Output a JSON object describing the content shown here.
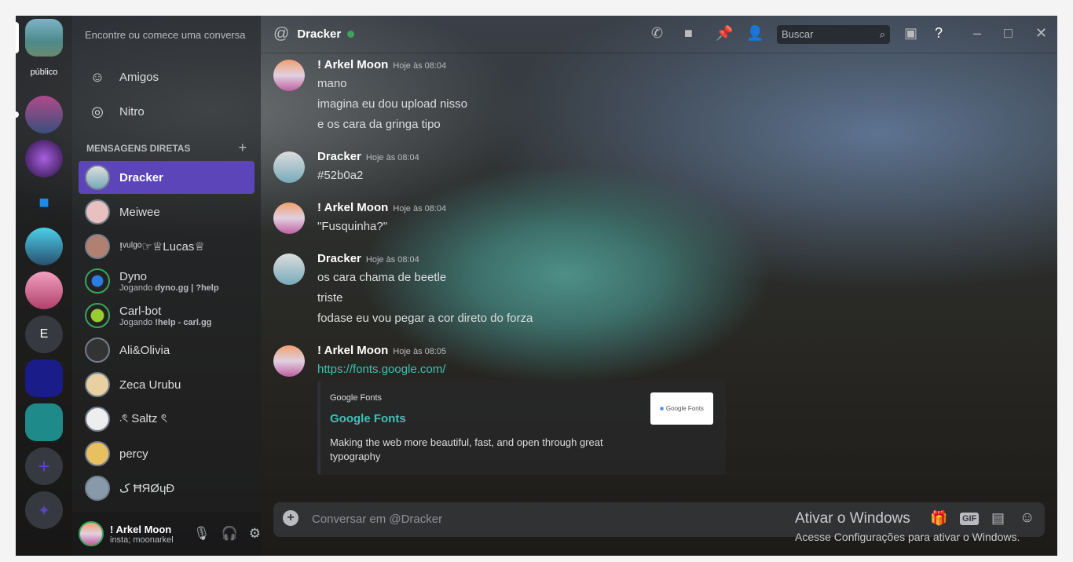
{
  "servers": {
    "public_label": "público",
    "letter_server": "E"
  },
  "sidebar": {
    "search_placeholder": "Encontre ou comece uma conversa",
    "friends": "Amigos",
    "nitro": "Nitro",
    "dm_header": "MENSAGENS DIRETAS",
    "dms": [
      {
        "name": "Dracker"
      },
      {
        "name": "Meiwee"
      },
      {
        "name": "!ᵛᵘˡᵍᵒ☞♕Lucas♕"
      },
      {
        "name": "Dyno",
        "status_prefix": "Jogando ",
        "status": "dyno.gg | ?help"
      },
      {
        "name": "Carl-bot",
        "status_prefix": "Jogando ",
        "status": "!help - carl.gg"
      },
      {
        "name": "Ali&Olivia"
      },
      {
        "name": "Zeca Urubu"
      },
      {
        "name": "܁ৎ Saltz ৎ"
      },
      {
        "name": "percy"
      },
      {
        "name": "ک ĦЯØɥĐ"
      }
    ]
  },
  "user": {
    "name": "! Arkel Moon",
    "status": "insta; moonarkel"
  },
  "header": {
    "title": "Dracker",
    "search_placeholder": "Buscar"
  },
  "messages": [
    {
      "author": "! Arkel Moon",
      "time": "Hoje às 08:04",
      "lines": [
        "mano",
        "imagina eu dou upload nisso",
        "e os cara da gringa tipo"
      ]
    },
    {
      "author": "Dracker",
      "time": "Hoje às 08:04",
      "lines": [
        "#52b0a2"
      ]
    },
    {
      "author": "! Arkel Moon",
      "time": "Hoje às 08:04",
      "lines": [
        "\"Fusquinha?\""
      ]
    },
    {
      "author": "Dracker",
      "time": "Hoje às 08:04",
      "lines": [
        "os cara chama de beetle",
        "triste",
        "fodase eu vou pegar a cor direto do forza"
      ]
    },
    {
      "author": "! Arkel Moon",
      "time": "Hoje às 08:05",
      "link": "https://fonts.google.com/"
    }
  ],
  "embed": {
    "provider": "Google Fonts",
    "title": "Google Fonts",
    "description": "Making the web more beautiful, fast, and open through great typography",
    "thumb_text": "Google Fonts"
  },
  "composer": {
    "placeholder": "Conversar em @Dracker",
    "gif": "GIF"
  },
  "watermark": {
    "title": "Ativar o Windows",
    "subtitle": "Acesse Configurações para ativar o Windows."
  },
  "colors": {
    "accent": "#5b45b9",
    "online": "#3ba55d",
    "link": "#00b0f4",
    "embed_title": "#3ec1b4"
  }
}
